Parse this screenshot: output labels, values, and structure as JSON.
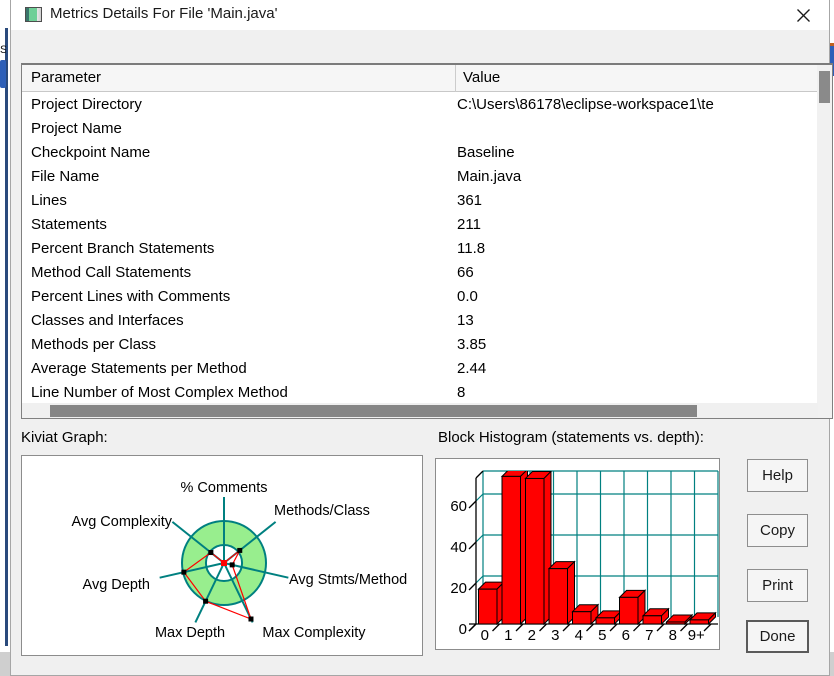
{
  "window": {
    "title": "Metrics Details For File 'Main.java'"
  },
  "table": {
    "headers": [
      "Parameter",
      "Value"
    ],
    "rows": [
      [
        "Project Directory",
        "C:\\Users\\86178\\eclipse-workspace1\\te"
      ],
      [
        "Project Name",
        ""
      ],
      [
        "Checkpoint Name",
        "Baseline"
      ],
      [
        "File Name",
        "Main.java"
      ],
      [
        "Lines",
        "361"
      ],
      [
        "Statements",
        "211"
      ],
      [
        "Percent Branch Statements",
        "11.8"
      ],
      [
        "Method Call Statements",
        "66"
      ],
      [
        "Percent Lines with Comments",
        "0.0"
      ],
      [
        "Classes and Interfaces",
        "13"
      ],
      [
        "Methods per Class",
        "3.85"
      ],
      [
        "Average Statements per Method",
        "2.44"
      ],
      [
        "Line Number of Most Complex Method",
        "8"
      ]
    ]
  },
  "sections": {
    "kiviat_label": "Kiviat Graph:",
    "histogram_label": "Block Histogram (statements vs. depth):"
  },
  "buttons": [
    {
      "label": "Help",
      "default": false
    },
    {
      "label": "Copy",
      "default": false
    },
    {
      "label": "Print",
      "default": false
    },
    {
      "label": "Done",
      "default": true
    }
  ],
  "colors": {
    "teal": "#008080",
    "kiviat_ring_green": "#98ee8e",
    "data_red": "#ff0000",
    "marker_black": "#000000",
    "bar_red": "#ff0000",
    "dialog_bg": "#f0f0f0",
    "titlebar_bg": "#ffffff",
    "scroll_thumb": "#8a8a8a"
  },
  "chart_data": [
    {
      "type": "radar",
      "title": "Kiviat Graph:",
      "axes": [
        "% Comments",
        "Methods/Class",
        "Avg Stmts/Method",
        "Max Complexity",
        "Max Depth",
        "Avg Depth",
        "Avg Complexity"
      ],
      "values_fraction_of_outer_ring": [
        0,
        0.48,
        0.2,
        1.48,
        1.01,
        0.98,
        0.4
      ],
      "rings": {
        "inner_radius_fraction": 0.43,
        "outer_radius_fraction": 1.0
      },
      "legend_note": "green annulus with teal spokes; red polygon with black square markers; red dot at center"
    },
    {
      "type": "bar",
      "title": "Block Histogram (statements vs. depth):",
      "categories": [
        "0",
        "1",
        "2",
        "3",
        "4",
        "5",
        "6",
        "7",
        "8",
        "9+"
      ],
      "values": [
        17,
        72,
        71,
        27,
        6,
        3,
        13,
        4,
        1,
        2
      ],
      "xlabel": "",
      "ylabel": "",
      "yticks": [
        0,
        20,
        40,
        60
      ],
      "ylim": [
        0,
        76
      ],
      "grid": true,
      "style": "3d-red-blocks-teal-grid"
    }
  ]
}
